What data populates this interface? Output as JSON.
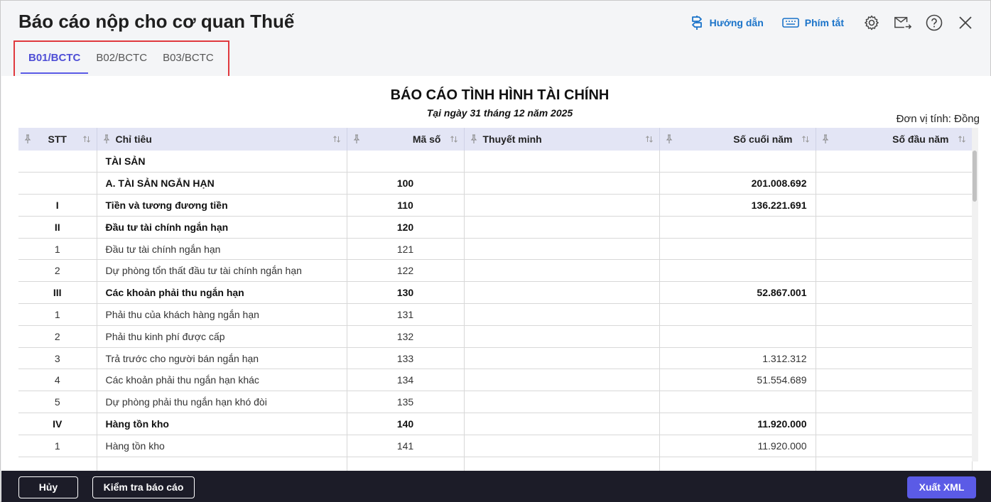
{
  "window": {
    "title": "Báo cáo nộp cho cơ quan Thuế"
  },
  "toolbar": {
    "guide_label": "Hướng dẫn",
    "shortcut_label": "Phím tắt",
    "icons": [
      "settings-icon",
      "mail-forward-icon",
      "help-icon",
      "close-icon"
    ]
  },
  "tabs": [
    {
      "label": "B01/BCTC",
      "active": true
    },
    {
      "label": "B02/BCTC",
      "active": false
    },
    {
      "label": "B03/BCTC",
      "active": false
    }
  ],
  "report": {
    "title": "BÁO CÁO TÌNH HÌNH TÀI CHÍNH",
    "subtitle": "Tại ngày 31 tháng 12 năm 2025",
    "unit": "Đơn vị tính: Đồng"
  },
  "table": {
    "columns": [
      "STT",
      "Chỉ tiêu",
      "Mã số",
      "Thuyết minh",
      "Số cuối năm",
      "Số đầu năm"
    ],
    "rows": [
      {
        "stt": "",
        "name": "TÀI SẢN",
        "code": "",
        "note": "",
        "end": "",
        "begin": "",
        "bold": true
      },
      {
        "stt": "",
        "name": "A. TÀI SẢN NGẮN HẠN",
        "code": "100",
        "note": "",
        "end": "201.008.692",
        "begin": "",
        "bold": true
      },
      {
        "stt": "I",
        "name": "Tiền và tương đương tiền",
        "code": "110",
        "note": "",
        "end": "136.221.691",
        "begin": "",
        "bold": true
      },
      {
        "stt": "II",
        "name": "Đầu tư tài chính ngắn hạn",
        "code": "120",
        "note": "",
        "end": "",
        "begin": "",
        "bold": true
      },
      {
        "stt": "1",
        "name": "Đầu tư tài chính ngắn hạn",
        "code": "121",
        "note": "",
        "end": "",
        "begin": "",
        "bold": false
      },
      {
        "stt": "2",
        "name": "Dự phòng tổn thất đầu tư tài chính ngắn hạn",
        "code": "122",
        "note": "",
        "end": "",
        "begin": "",
        "bold": false
      },
      {
        "stt": "III",
        "name": "Các khoản phải thu ngắn hạn",
        "code": "130",
        "note": "",
        "end": "52.867.001",
        "begin": "",
        "bold": true
      },
      {
        "stt": "1",
        "name": "Phải thu của khách hàng ngắn hạn",
        "code": "131",
        "note": "",
        "end": "",
        "begin": "",
        "bold": false
      },
      {
        "stt": "2",
        "name": "Phải thu kinh phí được cấp",
        "code": "132",
        "note": "",
        "end": "",
        "begin": "",
        "bold": false
      },
      {
        "stt": "3",
        "name": "Trả trước cho người bán ngắn hạn",
        "code": "133",
        "note": "",
        "end": "1.312.312",
        "begin": "",
        "bold": false
      },
      {
        "stt": "4",
        "name": "Các khoản phải thu ngắn hạn khác",
        "code": "134",
        "note": "",
        "end": "51.554.689",
        "begin": "",
        "bold": false
      },
      {
        "stt": "5",
        "name": "Dự phòng phải thu ngắn hạn khó đòi",
        "code": "135",
        "note": "",
        "end": "",
        "begin": "",
        "bold": false
      },
      {
        "stt": "IV",
        "name": "Hàng tồn kho",
        "code": "140",
        "note": "",
        "end": "11.920.000",
        "begin": "",
        "bold": true
      },
      {
        "stt": "1",
        "name": "Hàng tồn kho",
        "code": "141",
        "note": "",
        "end": "11.920.000",
        "begin": "",
        "bold": false
      },
      {
        "stt": "",
        "name": "",
        "code": "",
        "note": "",
        "end": "",
        "begin": "",
        "bold": false
      }
    ]
  },
  "footer": {
    "cancel_label": "Hủy",
    "check_label": "Kiểm tra báo cáo",
    "export_label": "Xuất XML"
  },
  "colors": {
    "accent": "#5b5be6",
    "link": "#1a73c9",
    "highlight_box": "#e0393e",
    "footer_bg": "#1c1c28",
    "header_row_bg": "#e3e5f5"
  }
}
